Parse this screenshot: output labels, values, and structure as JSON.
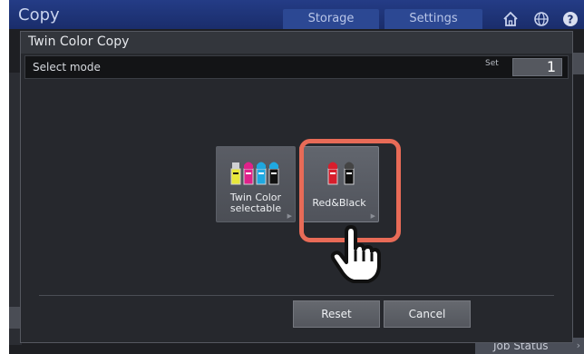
{
  "topbar": {
    "app_title": "Copy",
    "tabs": [
      {
        "label": "Storage"
      },
      {
        "label": "Settings"
      }
    ],
    "icons": [
      "home-icon",
      "globe-icon",
      "help-icon"
    ]
  },
  "dialog": {
    "title": "Twin Color Copy",
    "mode_label": "Select mode",
    "set_label": "Set",
    "set_value": "1",
    "modes": [
      {
        "label_line1": "Twin Color",
        "label_line2": "selectable",
        "icon": "four-color-toner-icon"
      },
      {
        "label_line1": "Red&Black",
        "label_line2": "",
        "icon": "red-black-toner-icon",
        "highlighted": true
      }
    ],
    "reset_label": "Reset",
    "cancel_label": "Cancel"
  },
  "background": {
    "job_status_label": "Job Status"
  },
  "colors": {
    "highlight": "#e86b57",
    "topbar": "#243c86"
  }
}
